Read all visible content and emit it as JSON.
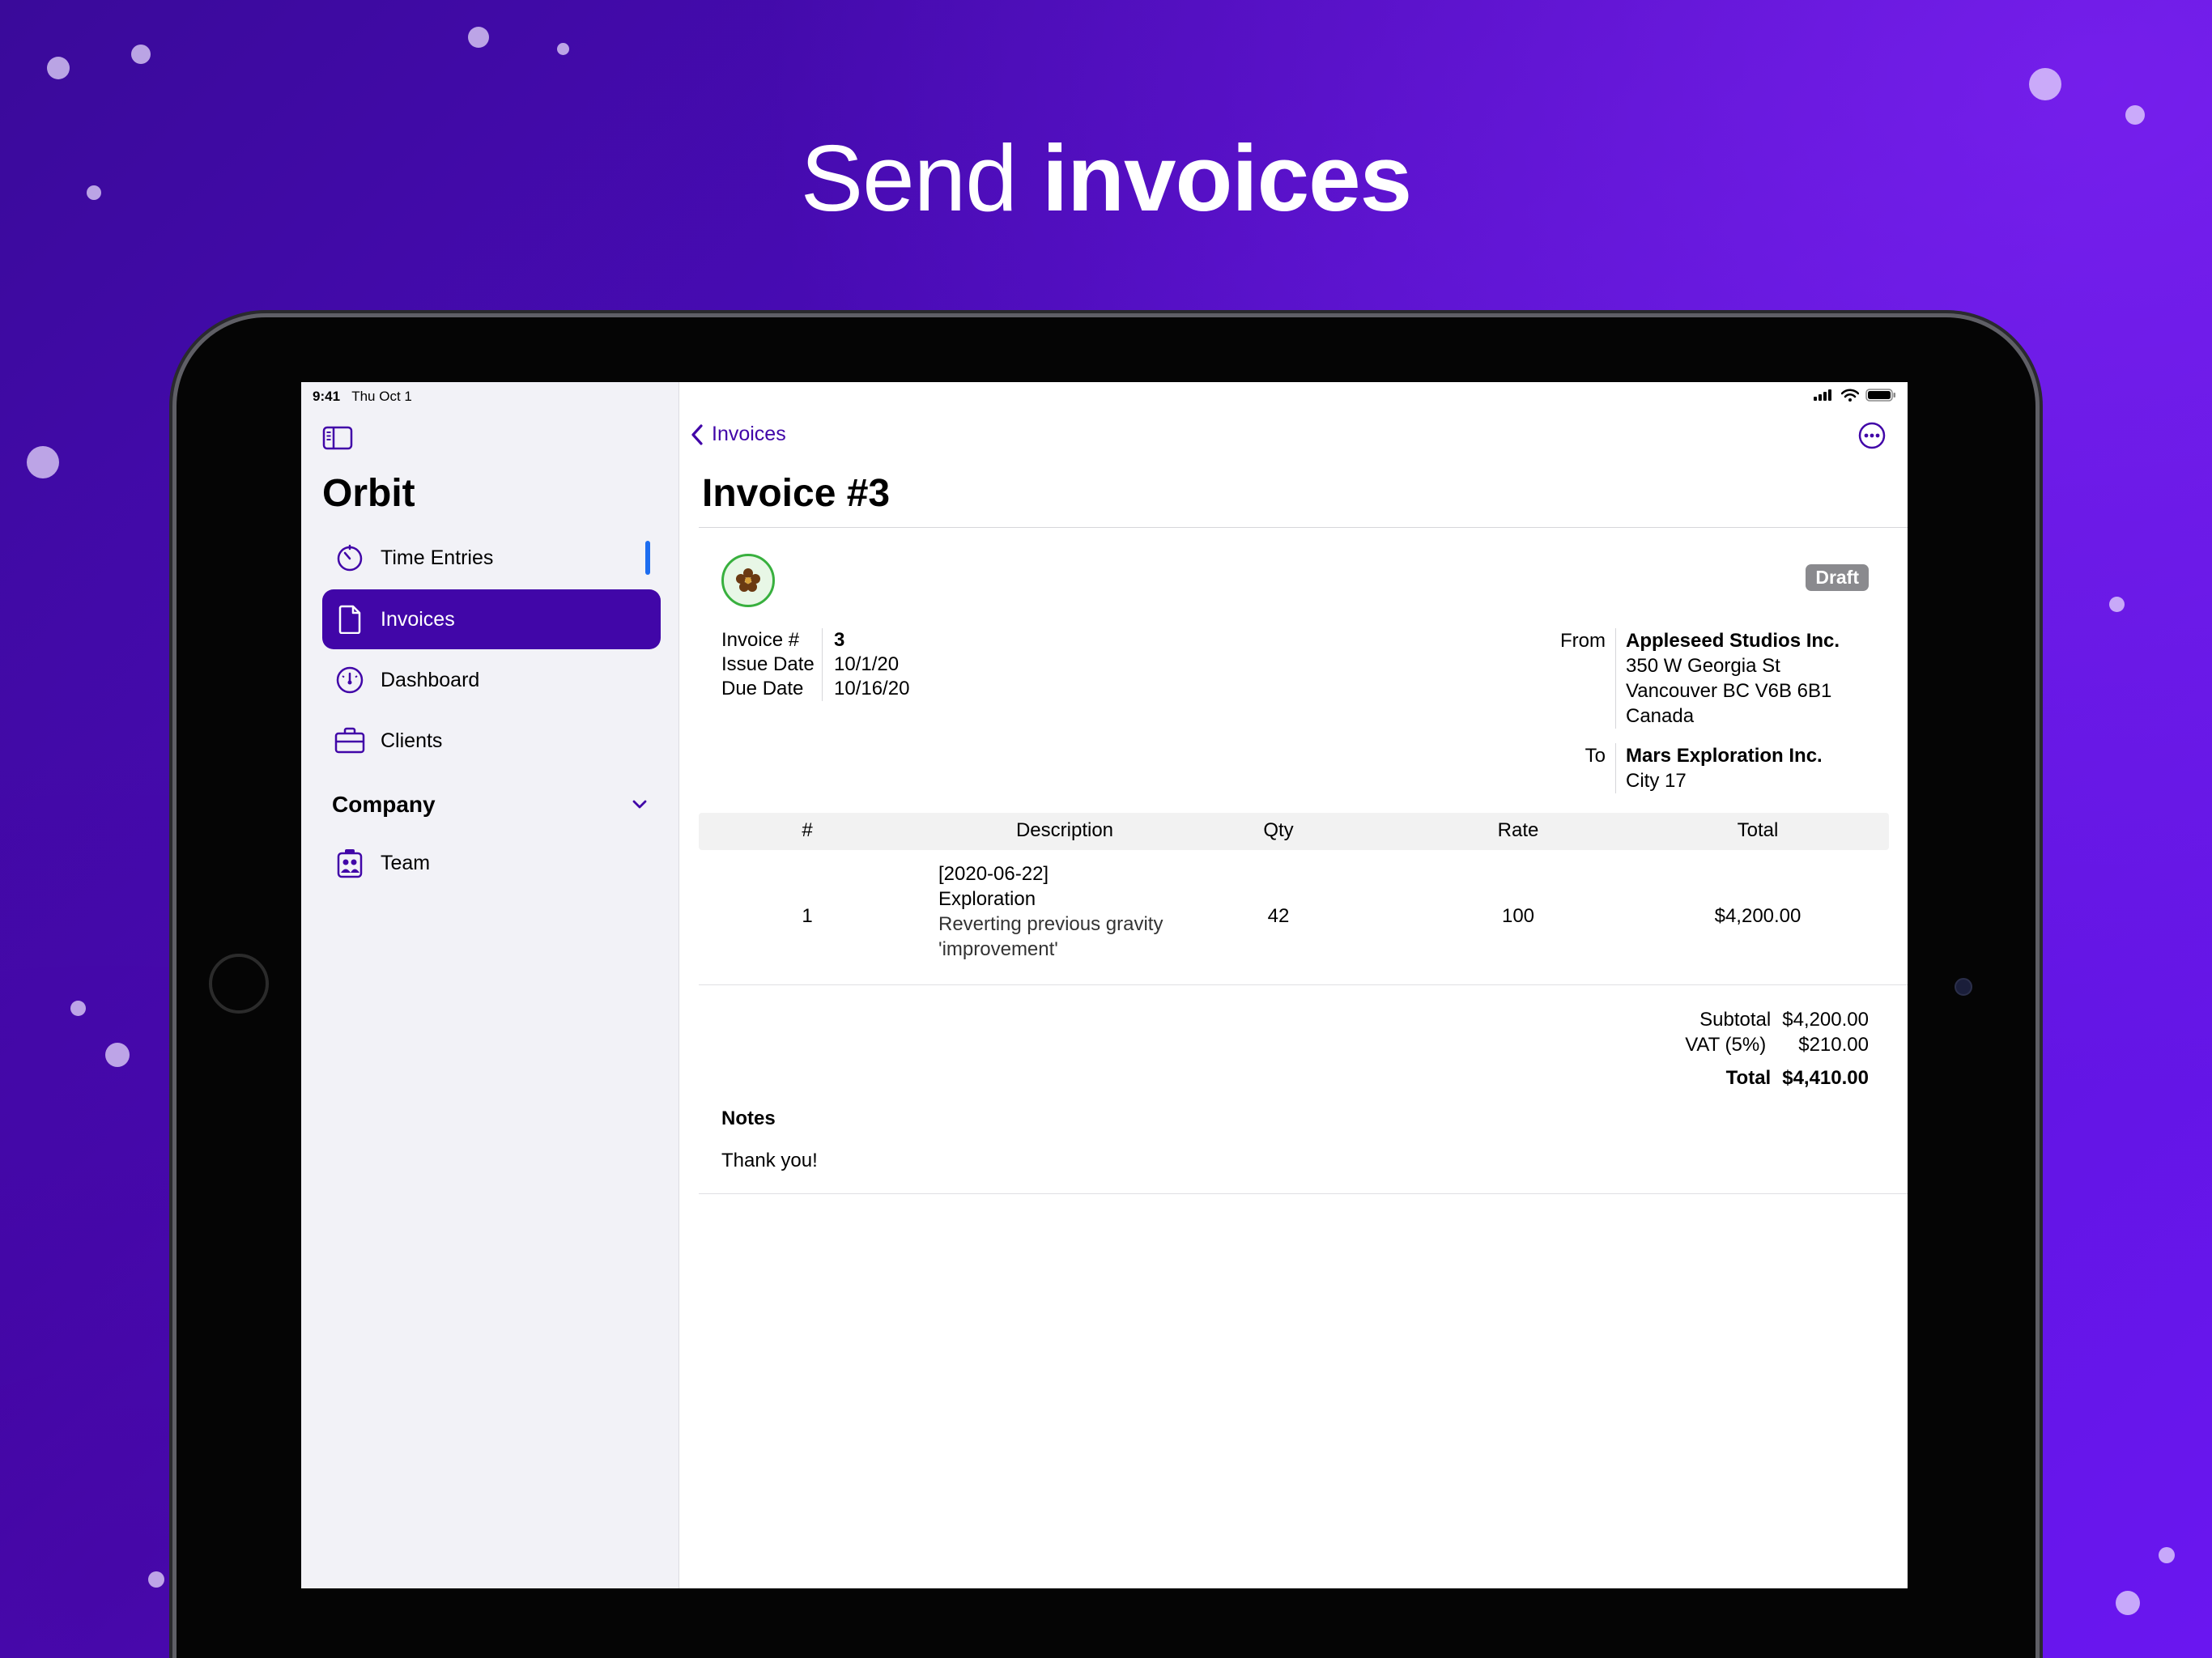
{
  "headline": {
    "light": "Send",
    "bold": "invoices"
  },
  "status_bar": {
    "time": "9:41",
    "date": "Thu Oct 1"
  },
  "sidebar": {
    "app_title": "Orbit",
    "items": [
      {
        "label": "Time Entries",
        "icon": "timer-icon"
      },
      {
        "label": "Invoices",
        "icon": "document-icon",
        "active": true
      },
      {
        "label": "Dashboard",
        "icon": "gauge-icon"
      },
      {
        "label": "Clients",
        "icon": "briefcase-icon"
      }
    ],
    "section": {
      "title": "Company"
    },
    "section_items": [
      {
        "label": "Team",
        "icon": "team-icon"
      }
    ]
  },
  "detail": {
    "back_label": "Invoices",
    "title": "Invoice #3",
    "status_badge": "Draft",
    "meta": [
      {
        "key": "Invoice #",
        "value": "3"
      },
      {
        "key": "Issue Date",
        "value": "10/1/20"
      },
      {
        "key": "Due Date",
        "value": "10/16/20"
      }
    ],
    "from": {
      "label": "From",
      "name": "Appleseed Studios Inc.",
      "lines": [
        "350 W Georgia St",
        "Vancouver BC V6B 6B1",
        "Canada"
      ]
    },
    "to": {
      "label": "To",
      "name": "Mars Exploration Inc.",
      "lines": [
        "City 17"
      ]
    },
    "table": {
      "headers": [
        "#",
        "Description",
        "Qty",
        "Rate",
        "Total"
      ],
      "rows": [
        {
          "num": "1",
          "date": "[2020-06-22]",
          "title": "Exploration",
          "note_line1": "Reverting previous gravity",
          "note_line2": "'improvement'",
          "qty": "42",
          "rate": "100",
          "total": "$4,200.00"
        }
      ]
    },
    "totals": {
      "subtotal_label": "Subtotal",
      "subtotal": "$4,200.00",
      "vat_label": "VAT (5%)",
      "vat": "$210.00",
      "total_label": "Total",
      "total": "$4,410.00"
    },
    "notes": {
      "heading": "Notes",
      "body": "Thank you!"
    }
  },
  "colors": {
    "accent": "#4106a8",
    "badge": "#8a8a8e",
    "logo_ring": "#38b03e",
    "scroll_indicator": "#1d6df0"
  }
}
